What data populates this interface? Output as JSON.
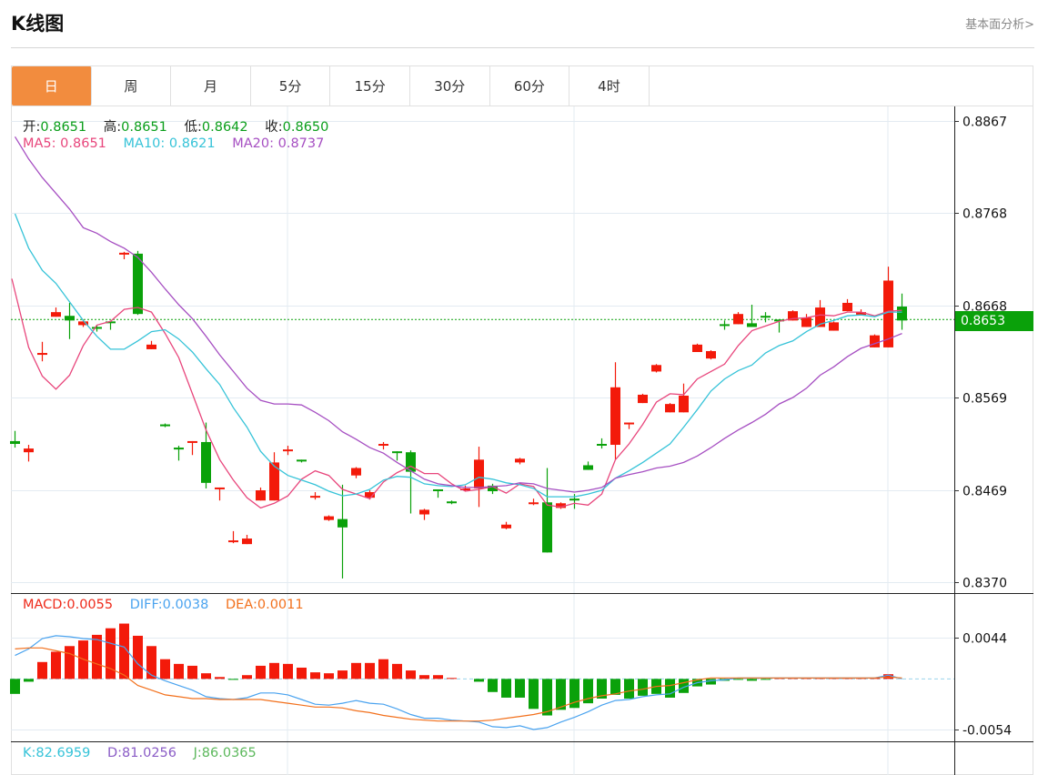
{
  "header": {
    "title": "K线图",
    "fundamental_link": "基本面分析>"
  },
  "tabs": [
    {
      "label": "日",
      "active": true
    },
    {
      "label": "周",
      "active": false
    },
    {
      "label": "月",
      "active": false
    },
    {
      "label": "5分",
      "active": false
    },
    {
      "label": "15分",
      "active": false
    },
    {
      "label": "30分",
      "active": false
    },
    {
      "label": "60分",
      "active": false
    },
    {
      "label": "4时",
      "active": false
    }
  ],
  "legend": {
    "open_label": "开:",
    "open": "0.8651",
    "high_label": "高:",
    "high": "0.8651",
    "low_label": "低:",
    "low": "0.8642",
    "close_label": "收:",
    "close": "0.8650",
    "ma5_label": "MA5: ",
    "ma5": "0.8651",
    "ma10_label": "MA10: ",
    "ma10": "0.8621",
    "ma20_label": "MA20: ",
    "ma20": "0.8737",
    "macd_label": "MACD:",
    "macd": "0.0055",
    "diff_label": "DIFF:",
    "diff": "0.0038",
    "dea_label": "DEA:",
    "dea": "0.0011",
    "k_label": "K:",
    "k": "82.6959",
    "d_label": "D:",
    "d": "81.0256",
    "j_label": "J:",
    "j": "86.0365"
  },
  "current_price": "0.8653",
  "colors": {
    "up": "#f31a0a",
    "down": "#0aa10a",
    "ma5": "#e8467c",
    "ma10": "#36c3d8",
    "ma20": "#a64fc2",
    "diff": "#4aa3ef",
    "dea": "#f2701c",
    "accent": "#f28c3e"
  },
  "chart_data": [
    {
      "type": "candlestick",
      "title": "K线图",
      "period": "日",
      "y_ticks": [
        "0.8867",
        "0.8768",
        "0.8668",
        "0.8569",
        "0.8469",
        "0.8370"
      ],
      "ylim": [
        0.837,
        0.8867
      ],
      "current_price": 0.8653,
      "candles_ochl": [
        [
          0.8522,
          0.8519,
          0.8533,
          0.8515
        ],
        [
          0.851,
          0.8514,
          0.8518,
          0.85
        ],
        [
          0.8615,
          0.8617,
          0.8629,
          0.8608
        ],
        [
          0.8656,
          0.8661,
          0.8666,
          0.8656
        ],
        [
          0.8657,
          0.8652,
          0.8671,
          0.8632
        ],
        [
          0.8647,
          0.8651,
          0.8653,
          0.8645
        ],
        [
          0.8645,
          0.8643,
          0.8647,
          0.864
        ],
        [
          0.8651,
          0.865,
          0.8651,
          0.8642
        ],
        [
          0.8723,
          0.8725,
          0.8726,
          0.8718
        ],
        [
          0.8724,
          0.8659,
          0.8727,
          0.8658
        ],
        [
          0.8621,
          0.8626,
          0.863,
          0.8621
        ],
        [
          0.854,
          0.8539,
          0.8541,
          0.8537
        ],
        [
          0.8515,
          0.8513,
          0.8517,
          0.8501
        ],
        [
          0.8521,
          0.8522,
          0.8522,
          0.8507
        ],
        [
          0.8521,
          0.8477,
          0.8542,
          0.8471
        ],
        [
          0.8471,
          0.8472,
          0.8472,
          0.8458
        ],
        [
          0.8414,
          0.8415,
          0.8425,
          0.8412
        ],
        [
          0.8411,
          0.8417,
          0.8421,
          0.8411
        ],
        [
          0.8458,
          0.8469,
          0.8472,
          0.8458
        ],
        [
          0.8458,
          0.8499,
          0.851,
          0.8458
        ],
        [
          0.8512,
          0.8513,
          0.8517,
          0.8507
        ],
        [
          0.8502,
          0.8501,
          0.8502,
          0.8499
        ],
        [
          0.8462,
          0.8463,
          0.8467,
          0.8459
        ],
        [
          0.8437,
          0.8441,
          0.8442,
          0.8436
        ],
        [
          0.8438,
          0.8429,
          0.8475,
          0.8374
        ],
        [
          0.8485,
          0.8493,
          0.8494,
          0.8482
        ],
        [
          0.8461,
          0.8467,
          0.8469,
          0.8459
        ],
        [
          0.8518,
          0.8519,
          0.8521,
          0.8513
        ],
        [
          0.8511,
          0.851,
          0.8511,
          0.8501
        ],
        [
          0.851,
          0.8489,
          0.8512,
          0.8444
        ],
        [
          0.8443,
          0.8448,
          0.8449,
          0.8437
        ],
        [
          0.847,
          0.8469,
          0.847,
          0.8461
        ],
        [
          0.8457,
          0.8456,
          0.8458,
          0.8454
        ],
        [
          0.847,
          0.8471,
          0.8474,
          0.8468
        ],
        [
          0.8471,
          0.8502,
          0.8516,
          0.8451
        ],
        [
          0.8474,
          0.8468,
          0.8476,
          0.8465
        ],
        [
          0.8428,
          0.8432,
          0.8435,
          0.8427
        ],
        [
          0.8499,
          0.8503,
          0.8504,
          0.8497
        ],
        [
          0.8455,
          0.8456,
          0.846,
          0.8453
        ],
        [
          0.8456,
          0.8402,
          0.8493,
          0.8402
        ],
        [
          0.845,
          0.8455,
          0.8456,
          0.8449
        ],
        [
          0.846,
          0.8458,
          0.8465,
          0.8449
        ],
        [
          0.8496,
          0.8491,
          0.85,
          0.8491
        ],
        [
          0.8519,
          0.8518,
          0.8525,
          0.8514
        ],
        [
          0.8518,
          0.858,
          0.8607,
          0.8502
        ],
        [
          0.8541,
          0.8542,
          0.8542,
          0.8535
        ],
        [
          0.8563,
          0.8572,
          0.8573,
          0.8563
        ],
        [
          0.8597,
          0.8604,
          0.8605,
          0.8596
        ],
        [
          0.8553,
          0.8562,
          0.8563,
          0.8553
        ],
        [
          0.8553,
          0.8571,
          0.8584,
          0.8553
        ],
        [
          0.8618,
          0.8626,
          0.8627,
          0.8618
        ],
        [
          0.8611,
          0.8619,
          0.862,
          0.861
        ],
        [
          0.8648,
          0.8647,
          0.8652,
          0.8642
        ],
        [
          0.8648,
          0.8659,
          0.8661,
          0.8648
        ],
        [
          0.8649,
          0.8645,
          0.8669,
          0.8645
        ],
        [
          0.8657,
          0.8656,
          0.8661,
          0.865
        ],
        [
          0.8653,
          0.8652,
          0.8653,
          0.8639
        ],
        [
          0.8652,
          0.8662,
          0.8663,
          0.8652
        ],
        [
          0.8645,
          0.8655,
          0.8659,
          0.8645
        ],
        [
          0.8645,
          0.8666,
          0.8674,
          0.8645
        ],
        [
          0.8641,
          0.865,
          0.8651,
          0.8641
        ],
        [
          0.8662,
          0.8671,
          0.8675,
          0.8662
        ],
        [
          0.8658,
          0.8661,
          0.8664,
          0.8658
        ],
        [
          0.8623,
          0.8636,
          0.8637,
          0.8623
        ],
        [
          0.8623,
          0.8695,
          0.871,
          0.8623
        ],
        [
          0.8667,
          0.8652,
          0.8681,
          0.8642
        ]
      ],
      "series": [
        {
          "name": "MA5",
          "values": [
            0.8697,
            0.8623,
            0.8592,
            0.8578,
            0.8593,
            0.8625,
            0.8647,
            0.8651,
            0.8664,
            0.8666,
            0.8661,
            0.8638,
            0.8612,
            0.8573,
            0.8534,
            0.8502,
            0.848,
            0.8461,
            0.845,
            0.8455,
            0.8463,
            0.8481,
            0.849,
            0.8485,
            0.847,
            0.8465,
            0.846,
            0.8478,
            0.8488,
            0.8495,
            0.8487,
            0.8487,
            0.8476,
            0.8468,
            0.847,
            0.8473,
            0.8466,
            0.8476,
            0.8473,
            0.8453,
            0.8451,
            0.8455,
            0.8453,
            0.8465,
            0.8502,
            0.8519,
            0.854,
            0.8564,
            0.8573,
            0.8572,
            0.8589,
            0.8597,
            0.8605,
            0.8625,
            0.8641,
            0.8646,
            0.8651,
            0.8654,
            0.8655,
            0.8658,
            0.8657,
            0.8661,
            0.8661,
            0.8657,
            0.8662,
            0.8663
          ]
        },
        {
          "name": "MA10",
          "values": [
            0.8767,
            0.873,
            0.8706,
            0.8692,
            0.8672,
            0.8652,
            0.8635,
            0.8621,
            0.8621,
            0.863,
            0.864,
            0.8642,
            0.8632,
            0.8618,
            0.86,
            0.8583,
            0.8558,
            0.8537,
            0.8511,
            0.8495,
            0.8485,
            0.848,
            0.8475,
            0.8468,
            0.8463,
            0.8465,
            0.847,
            0.848,
            0.8484,
            0.8483,
            0.8476,
            0.8474,
            0.8473,
            0.8475,
            0.8483,
            0.8481,
            0.8477,
            0.8475,
            0.8471,
            0.8462,
            0.8462,
            0.8462,
            0.8465,
            0.8469,
            0.8482,
            0.849,
            0.8499,
            0.8509,
            0.8519,
            0.8537,
            0.8556,
            0.8576,
            0.8589,
            0.8598,
            0.8604,
            0.8617,
            0.8625,
            0.863,
            0.864,
            0.8648,
            0.8652,
            0.8657,
            0.8658,
            0.8656,
            0.8661,
            0.8661
          ]
        },
        {
          "name": "MA20",
          "values": [
            0.885,
            0.8826,
            0.8806,
            0.8789,
            0.8772,
            0.8752,
            0.8746,
            0.8737,
            0.873,
            0.872,
            0.8704,
            0.8686,
            0.8669,
            0.8654,
            0.8635,
            0.8615,
            0.8597,
            0.8579,
            0.8566,
            0.8562,
            0.8562,
            0.8561,
            0.8553,
            0.8544,
            0.8532,
            0.8524,
            0.8515,
            0.8509,
            0.8499,
            0.849,
            0.8481,
            0.8476,
            0.8474,
            0.8472,
            0.8472,
            0.8473,
            0.8474,
            0.8477,
            0.8476,
            0.8471,
            0.8469,
            0.8467,
            0.8469,
            0.8472,
            0.8482,
            0.8486,
            0.8489,
            0.8493,
            0.8495,
            0.8499,
            0.8506,
            0.8515,
            0.8525,
            0.8534,
            0.8542,
            0.8551,
            0.8562,
            0.8569,
            0.8579,
            0.8593,
            0.8602,
            0.8613,
            0.8622,
            0.8627,
            0.8632,
            0.8638
          ]
        }
      ]
    },
    {
      "type": "bar+line",
      "title": "MACD",
      "y_ticks": [
        "0.0044",
        "-0.0054"
      ],
      "ylim": [
        -0.0054,
        0.0044
      ],
      "macd": [
        -0.0016,
        -0.0003,
        0.0018,
        0.0029,
        0.0035,
        0.0041,
        0.0047,
        0.0054,
        0.0059,
        0.0046,
        0.0035,
        0.0021,
        0.0016,
        0.0014,
        0.0006,
        0.0002,
        -0.0001,
        0.0004,
        0.0014,
        0.0017,
        0.0016,
        0.0012,
        0.0007,
        0.0006,
        0.0009,
        0.0017,
        0.0017,
        0.0021,
        0.0016,
        0.0009,
        0.0004,
        0.0004,
        0.0001,
        0.0,
        -0.0003,
        -0.0014,
        -0.002,
        -0.002,
        -0.0032,
        -0.0039,
        -0.0033,
        -0.0031,
        -0.0026,
        -0.0021,
        -0.0017,
        -0.0021,
        -0.0018,
        -0.0016,
        -0.002,
        -0.0015,
        -0.0008,
        -0.0006,
        -0.0002,
        -0.0001,
        -0.0002,
        -0.0001,
        0.0001,
        0.0001,
        0.0001,
        0.0001,
        0.0001,
        0.0001,
        0.0001,
        0.0001,
        0.0005,
        0.0
      ],
      "diff": [
        0.0025,
        0.0032,
        0.0043,
        0.0046,
        0.0045,
        0.0043,
        0.0042,
        0.0038,
        0.0034,
        0.0016,
        0.0004,
        -0.0002,
        -0.0007,
        -0.0012,
        -0.0019,
        -0.0021,
        -0.0022,
        -0.002,
        -0.0015,
        -0.0015,
        -0.0017,
        -0.0022,
        -0.0027,
        -0.0028,
        -0.0026,
        -0.0023,
        -0.0026,
        -0.0027,
        -0.0032,
        -0.0038,
        -0.0042,
        -0.0042,
        -0.0044,
        -0.0045,
        -0.0046,
        -0.0051,
        -0.0052,
        -0.005,
        -0.0054,
        -0.0052,
        -0.0046,
        -0.0041,
        -0.0035,
        -0.0028,
        -0.0023,
        -0.0022,
        -0.0019,
        -0.0017,
        -0.0016,
        -0.0009,
        -0.0004,
        -0.0002,
        -0.0001,
        0.0001,
        0.0001,
        0.0001,
        0.0001,
        0.0001,
        0.0001,
        0.0001,
        0.0001,
        0.0001,
        0.0001,
        0.0001,
        0.0004,
        0.0
      ],
      "dea": [
        0.0032,
        0.0033,
        0.0033,
        0.003,
        0.0027,
        0.0021,
        0.0016,
        0.0011,
        0.0004,
        -0.0007,
        -0.0012,
        -0.0017,
        -0.0019,
        -0.0021,
        -0.0021,
        -0.0022,
        -0.0022,
        -0.0022,
        -0.0022,
        -0.0024,
        -0.0026,
        -0.0028,
        -0.003,
        -0.003,
        -0.0031,
        -0.0034,
        -0.0036,
        -0.0039,
        -0.0041,
        -0.0043,
        -0.0044,
        -0.0045,
        -0.0045,
        -0.0045,
        -0.0045,
        -0.0044,
        -0.0042,
        -0.004,
        -0.0038,
        -0.0035,
        -0.003,
        -0.0025,
        -0.0021,
        -0.0018,
        -0.0016,
        -0.0013,
        -0.0011,
        -0.0008,
        -0.0007,
        -0.0004,
        -0.0001,
        0.0001,
        0.0001,
        0.0001,
        0.0001,
        0.0001,
        0.0001,
        0.0001,
        0.0001,
        0.0001,
        0.0001,
        0.0001,
        0.0001,
        0.0001,
        0.0002,
        0.0001
      ]
    }
  ]
}
